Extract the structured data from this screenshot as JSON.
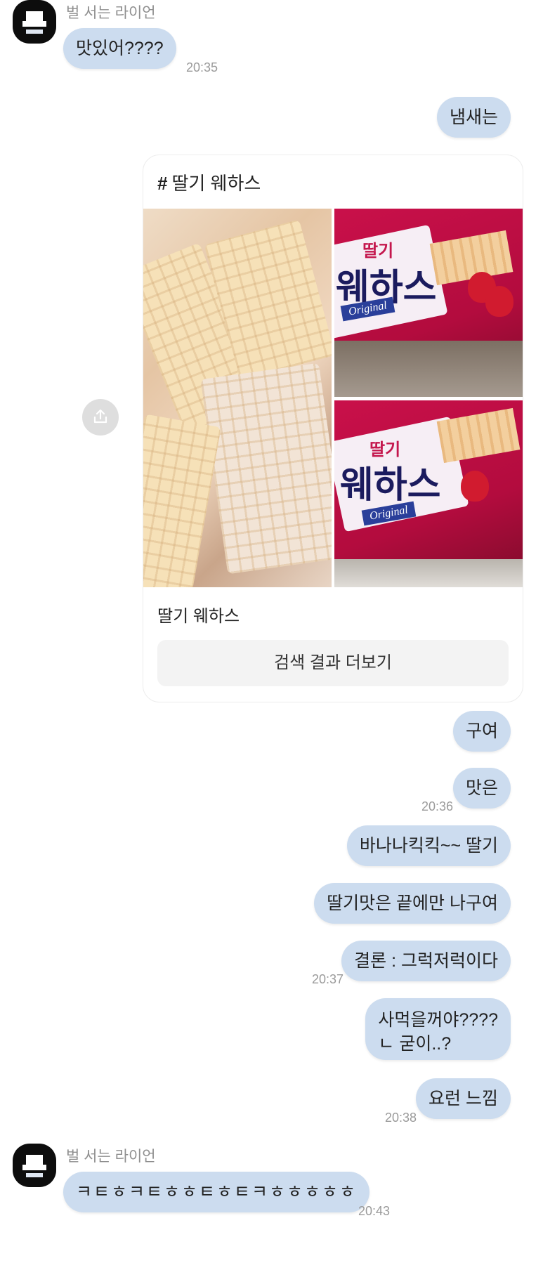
{
  "sender": {
    "name": "벌 서는 라이언"
  },
  "messages": [
    {
      "text": "맛있어????",
      "time": "20:35"
    },
    {
      "text": "냄새는"
    },
    {
      "text": "구여"
    },
    {
      "text": "맛은",
      "time": "20:36"
    },
    {
      "text": "바나나킥킥~~ 딸기"
    },
    {
      "text": "딸기맛은 끝에만 나구여"
    },
    {
      "text": "결론 : 그럭저럭이다",
      "time": "20:37"
    },
    {
      "lines": [
        "사먹을꺼야????",
        "ㄴ 굳이..?"
      ]
    },
    {
      "text": "요런 느낌",
      "time": "20:38"
    },
    {
      "text": "ㅋㅌㅎㅋㅌㅎㅎㅌㅎㅌㅋㅎㅎㅎㅎㅎ",
      "time": "20:43"
    }
  ],
  "card": {
    "hashtag": "#",
    "title": "딸기 웨하스",
    "caption": "딸기 웨하스",
    "button": "검색 결과 더보기",
    "package_brand_small": "딸기",
    "package_brand": "웨하스",
    "package_label": "Original"
  },
  "icons": {
    "share": "share-icon"
  },
  "colors": {
    "bubble": "#ccdcef",
    "background": "#ffffff"
  }
}
